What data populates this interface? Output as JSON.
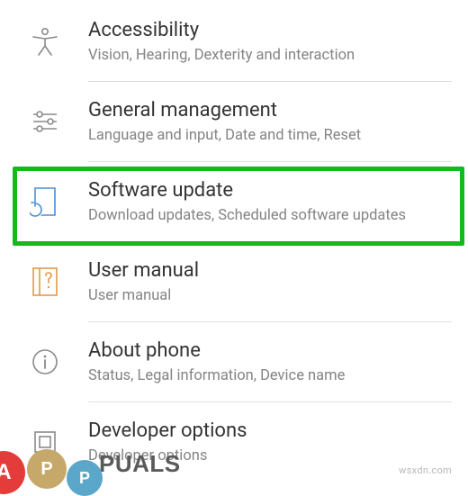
{
  "settings": {
    "items": [
      {
        "title": "Accessibility",
        "subtitle": "Vision, Hearing, Dexterity and interaction",
        "icon": "accessibility-icon",
        "highlight": false
      },
      {
        "title": "General management",
        "subtitle": "Language and input, Date and time, Reset",
        "icon": "sliders-icon",
        "highlight": false
      },
      {
        "title": "Software update",
        "subtitle": "Download updates, Scheduled software updates",
        "icon": "software-update-icon",
        "highlight": true
      },
      {
        "title": "User manual",
        "subtitle": "User manual",
        "icon": "manual-icon",
        "highlight": false
      },
      {
        "title": "About phone",
        "subtitle": "Status, Legal information, Device name",
        "icon": "info-icon",
        "highlight": false
      },
      {
        "title": "Developer options",
        "subtitle": "Developer options",
        "icon": "developer-icon",
        "highlight": false
      }
    ]
  },
  "watermark": {
    "right": "wsxdn.com",
    "left_text": "PUALS"
  },
  "colors": {
    "highlight": "#14b91d",
    "icon_gray": "#8a8a8a",
    "icon_blue": "#4a8fd6",
    "icon_orange": "#e09a4a"
  }
}
